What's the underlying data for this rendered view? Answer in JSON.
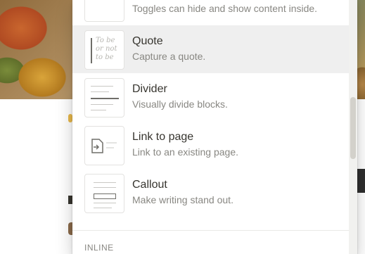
{
  "menu": {
    "items": [
      {
        "title": "",
        "description": "Toggles can hide and show content inside.",
        "icon": "toggle-list-icon"
      },
      {
        "title": "Quote",
        "description": "Capture a quote.",
        "icon": "quote-icon",
        "preview_text": "To be or not to be"
      },
      {
        "title": "Divider",
        "description": "Visually divide blocks.",
        "icon": "divider-icon"
      },
      {
        "title": "Link to page",
        "description": "Link to an existing page.",
        "icon": "link-to-page-icon"
      },
      {
        "title": "Callout",
        "description": "Make writing stand out.",
        "icon": "callout-icon"
      }
    ],
    "section_label": "INLINE",
    "hovered_item": "Quote"
  },
  "colors": {
    "hover_bg": "#efefef",
    "text_primary": "#37352f",
    "text_secondary": "#888782"
  }
}
